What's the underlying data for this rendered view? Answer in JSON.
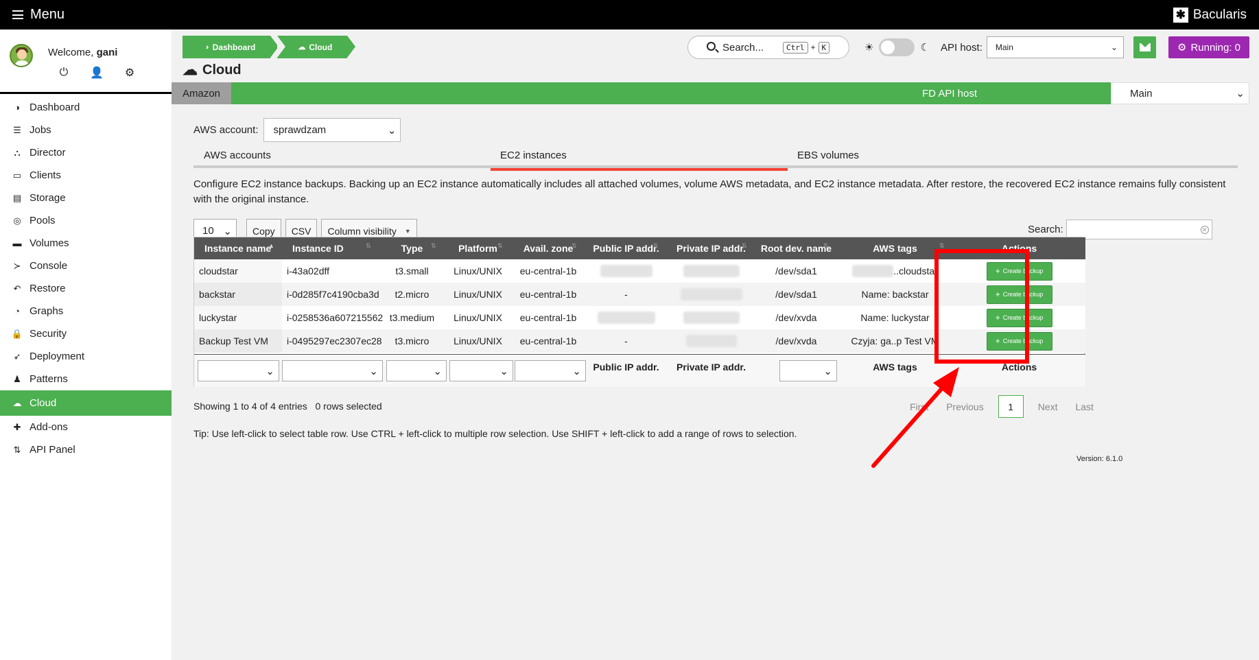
{
  "topbar": {
    "menu_label": "Menu",
    "brand": "Bacularis"
  },
  "user": {
    "welcome": "Welcome,",
    "name": "gani"
  },
  "sidebar": {
    "items": [
      {
        "label": "Dashboard",
        "icon": "dashboard-icon",
        "glyph": "◑"
      },
      {
        "label": "Jobs",
        "icon": "jobs-icon",
        "glyph": "☰"
      },
      {
        "label": "Director",
        "icon": "director-icon",
        "glyph": "⛬"
      },
      {
        "label": "Clients",
        "icon": "clients-icon",
        "glyph": "▭"
      },
      {
        "label": "Storage",
        "icon": "storage-icon",
        "glyph": "▤"
      },
      {
        "label": "Pools",
        "icon": "pools-icon",
        "glyph": "◎"
      },
      {
        "label": "Volumes",
        "icon": "volumes-icon",
        "glyph": "▬"
      },
      {
        "label": "Console",
        "icon": "console-icon",
        "glyph": "≻"
      },
      {
        "label": "Restore",
        "icon": "restore-icon",
        "glyph": "↶"
      },
      {
        "label": "Graphs",
        "icon": "graphs-icon",
        "glyph": "◔"
      },
      {
        "label": "Security",
        "icon": "security-icon",
        "glyph": "🔒"
      },
      {
        "label": "Deployment",
        "icon": "deployment-icon",
        "glyph": "➶"
      },
      {
        "label": "Patterns",
        "icon": "patterns-icon",
        "glyph": "♟"
      },
      {
        "label": "Cloud",
        "icon": "cloud-icon",
        "glyph": "☁"
      },
      {
        "label": "Add-ons",
        "icon": "addons-icon",
        "glyph": "✚"
      },
      {
        "label": "API Panel",
        "icon": "api-panel-icon",
        "glyph": "⇅"
      }
    ],
    "active_index": 13
  },
  "breadcrumb": [
    {
      "label": "Dashboard"
    },
    {
      "label": "Cloud"
    }
  ],
  "search": {
    "label": "Search...",
    "key1": "Ctrl",
    "plus": "+",
    "key2": "K"
  },
  "api_host": {
    "label": "API host:",
    "value": "Main"
  },
  "running": {
    "label": "Running: 0"
  },
  "page_title": "Cloud",
  "provider": {
    "tab": "Amazon",
    "fd_label": "FD API host",
    "fd_value": "Main"
  },
  "aws_account": {
    "label": "AWS account:",
    "value": "sprawdzam"
  },
  "tabs": [
    {
      "label": "AWS accounts"
    },
    {
      "label": "EC2 instances"
    },
    {
      "label": "EBS volumes"
    }
  ],
  "description": "Configure EC2 instance backups. Backing up an EC2 instance automatically includes all attached volumes, volume AWS metadata, and EC2 instance metadata. After restore, the recovered EC2 instance remains fully consistent with the original instance.",
  "table_controls": {
    "page_length": "10",
    "copy": "Copy",
    "csv": "CSV",
    "column_visibility": "Column visibility",
    "search_label": "Search:"
  },
  "columns": [
    "Instance name",
    "Instance ID",
    "Type",
    "Platform",
    "Avail. zone",
    "Public IP addr.",
    "Private IP addr.",
    "Root dev. name",
    "AWS tags",
    "Actions"
  ],
  "rows": [
    {
      "name": "cloudstar",
      "id": "i-43a02dff",
      "type": "t3.small",
      "platform": "Linux/UNIX",
      "zone": "eu-central-1b",
      "public_ip": "",
      "private_ip": "",
      "root_dev": "/dev/sda1",
      "tags": "..cloudstar",
      "action": "Create backup"
    },
    {
      "name": "backstar",
      "id": "i-0d285f7c4190cba3d",
      "type": "t2.micro",
      "platform": "Linux/UNIX",
      "zone": "eu-central-1b",
      "public_ip": "-",
      "private_ip": "",
      "root_dev": "/dev/sda1",
      "tags": "Name: backstar",
      "action": "Create backup"
    },
    {
      "name": "luckystar",
      "id": "i-0258536a607215562",
      "type": "t3.medium",
      "platform": "Linux/UNIX",
      "zone": "eu-central-1b",
      "public_ip": "",
      "private_ip": "",
      "root_dev": "/dev/xvda",
      "tags": "Name: luckystar",
      "action": "Create backup"
    },
    {
      "name": "Backup Test VM",
      "id": "i-0495297ec2307ec28",
      "type": "t3.micro",
      "platform": "Linux/UNIX",
      "zone": "eu-central-1b",
      "public_ip": "-",
      "private_ip": "",
      "root_dev": "/dev/xvda",
      "tags": "Czyja: ga..p Test VM",
      "action": "Create backup"
    }
  ],
  "footer_labels": {
    "public_ip": "Public IP addr.",
    "private_ip": "Private IP addr.",
    "tags": "AWS tags",
    "actions": "Actions"
  },
  "info": {
    "showing": "Showing 1 to 4 of 4 entries",
    "selected": "0 rows selected"
  },
  "pager": {
    "first": "First",
    "previous": "Previous",
    "current": "1",
    "next": "Next",
    "last": "Last"
  },
  "tip": "Tip: Use left-click to select table row. Use CTRL + left-click to multiple row selection. Use SHIFT + left-click to add a range of rows to selection.",
  "version": "Version: 6.1.0",
  "colors": {
    "green": "#4caf50",
    "purple": "#9c27b0",
    "annotation_red": "#ff0000",
    "tab_underline": "#f44336"
  }
}
